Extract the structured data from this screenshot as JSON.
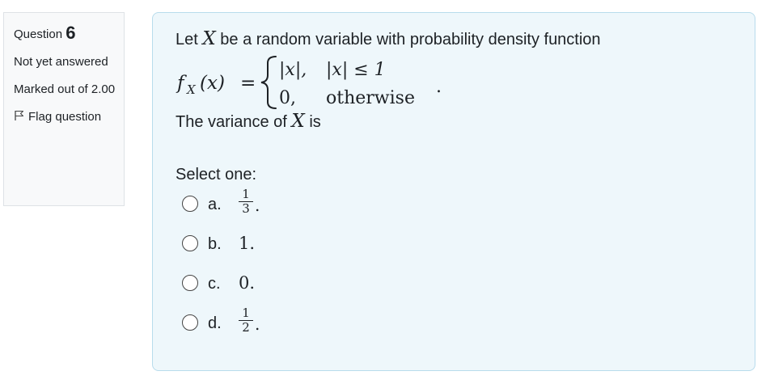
{
  "info": {
    "question_label": "Question",
    "question_number": "6",
    "state": "Not yet answered",
    "grade": "Marked out of 2.00",
    "flag_label": "Flag question"
  },
  "question": {
    "intro_prefix": "Let ",
    "intro_var": "X",
    "intro_suffix": " be a random variable with probability density function",
    "formula": {
      "lhs_f": "f",
      "lhs_sub": "X",
      "lhs_arg": "(x)",
      "equals": "=",
      "case1_value": "|x|,",
      "case1_condition": "|x| ≤ 1",
      "case2_value": "0,",
      "case2_condition": "otherwise",
      "end": "."
    },
    "variance_prefix": "The variance of ",
    "variance_var": "X",
    "variance_suffix": " is",
    "prompt": "Select one:"
  },
  "options": [
    {
      "letter": "a.",
      "numerator": "1",
      "denominator": "3",
      "end": "."
    },
    {
      "letter": "b.",
      "value": "1."
    },
    {
      "letter": "c.",
      "value": "0."
    },
    {
      "letter": "d.",
      "numerator": "1",
      "denominator": "2",
      "end": "."
    }
  ]
}
